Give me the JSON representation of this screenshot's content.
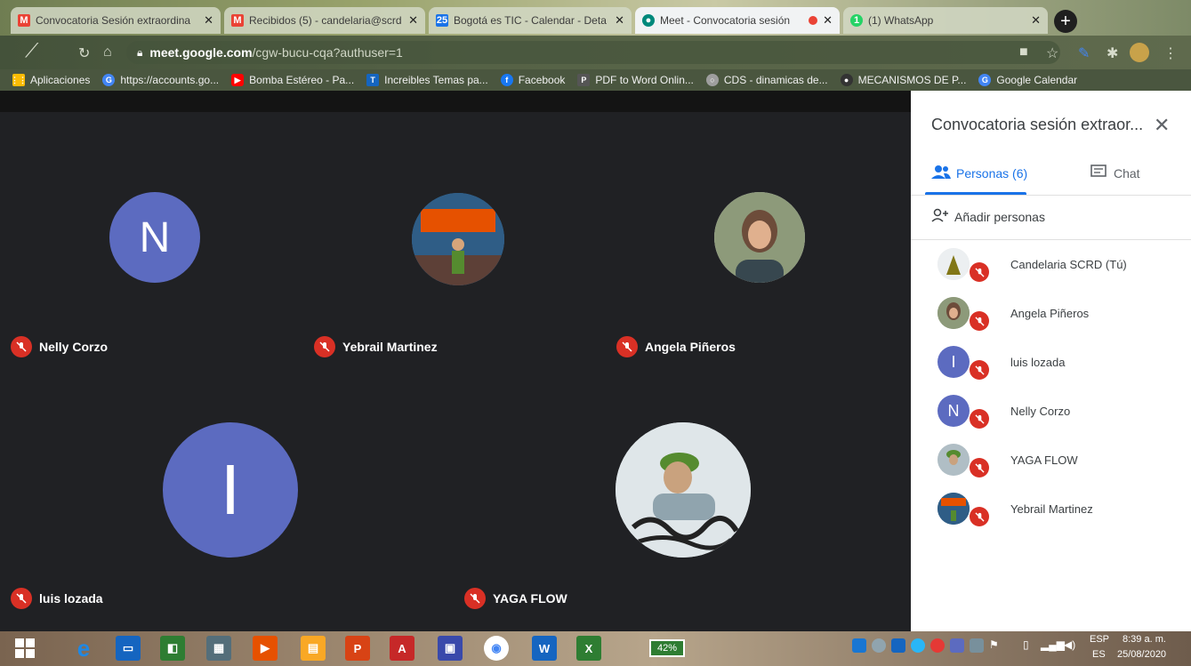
{
  "browser": {
    "tabs": [
      {
        "title": "Convocatoria Sesión extraordina",
        "favicon": "gmail-icon",
        "active": false
      },
      {
        "title": "Recibidos (5) - candelaria@scrd",
        "favicon": "gmail-icon",
        "active": false
      },
      {
        "title": "Bogotá es TIC - Calendar - Deta",
        "favicon": "calendar-icon",
        "favicon_text": "25",
        "active": false
      },
      {
        "title": "Meet - Convocatoria sesión",
        "favicon": "meet-icon",
        "active": true
      },
      {
        "title": "(1) WhatsApp",
        "favicon": "whatsapp-icon",
        "favicon_text": "1",
        "active": false
      }
    ],
    "url_host": "meet.google.com",
    "url_path": "/cgw-bucu-cqa?authuser=1",
    "bookmarks": [
      {
        "label": "Aplicaciones",
        "icon": "apps-icon",
        "color": "#fbbc04"
      },
      {
        "label": "https://accounts.go...",
        "icon": "google-icon",
        "color": "#4285f4"
      },
      {
        "label": "Bomba Estéreo - Pa...",
        "icon": "youtube-icon",
        "color": "#ff0000"
      },
      {
        "label": "Increibles Temas pa...",
        "icon": "t-icon",
        "color": "#1565c0"
      },
      {
        "label": "Facebook",
        "icon": "facebook-icon",
        "color": "#1877f2"
      },
      {
        "label": "PDF to Word Onlin...",
        "icon": "pdf-icon",
        "color": "#555555"
      },
      {
        "label": "CDS - dinamicas de...",
        "icon": "globe-icon",
        "color": "#9e9e9e"
      },
      {
        "label": "MECANISMOS DE P...",
        "icon": "mecanismos-icon",
        "color": "#333333"
      },
      {
        "label": "Google Calendar",
        "icon": "google-icon",
        "color": "#4285f4"
      }
    ]
  },
  "meet": {
    "tiles": [
      {
        "name": "Nelly Corzo",
        "initial": "N"
      },
      {
        "name": "Yebrail Martinez",
        "initial": ""
      },
      {
        "name": "Angela Piñeros",
        "initial": ""
      },
      {
        "name": "luis lozada",
        "initial": "I"
      },
      {
        "name": "YAGA FLOW",
        "initial": ""
      }
    ],
    "panel": {
      "title": "Convocatoria sesión extraor...",
      "tab_people": "Personas (6)",
      "tab_chat": "Chat",
      "add_people": "Añadir personas",
      "participants": [
        {
          "name": "Candelaria SCRD (Tú)",
          "initial": ""
        },
        {
          "name": "Angela Piñeros",
          "initial": ""
        },
        {
          "name": "luis lozada",
          "initial": "I"
        },
        {
          "name": "Nelly Corzo",
          "initial": "N"
        },
        {
          "name": "YAGA FLOW",
          "initial": ""
        },
        {
          "name": "Yebrail Martinez",
          "initial": ""
        }
      ]
    }
  },
  "taskbar": {
    "battery": "42%",
    "lang_primary": "ESP",
    "lang_secondary": "ES",
    "time": "8:39 a. m.",
    "date": "25/08/2020"
  },
  "colors": {
    "accent": "#1a73e8",
    "mic_off": "#d93025",
    "avatar_letter": "#5c6bc0"
  }
}
